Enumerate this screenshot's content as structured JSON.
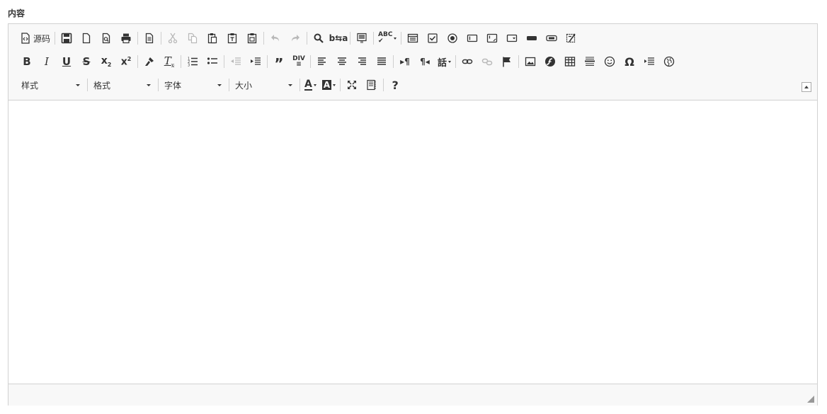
{
  "field": {
    "label": "内容"
  },
  "toolbar": {
    "source_label": "源码",
    "dropdowns": {
      "styles": "样式",
      "format": "格式",
      "font": "字体",
      "size": "大小"
    }
  },
  "icons": [
    "source-icon",
    "save-icon",
    "new-page-icon",
    "preview-icon",
    "print-icon",
    "templates-icon",
    "cut-icon",
    "copy-icon",
    "paste-icon",
    "paste-text-icon",
    "paste-word-icon",
    "undo-icon",
    "redo-icon",
    "find-icon",
    "replace-icon",
    "select-all-icon",
    "spellcheck-icon",
    "form-icon",
    "checkbox-icon",
    "radio-icon",
    "textfield-icon",
    "textarea-icon",
    "select-icon",
    "button-icon",
    "image-button-icon",
    "hidden-field-icon",
    "bold-icon",
    "italic-icon",
    "underline-icon",
    "strike-icon",
    "subscript-icon",
    "superscript-icon",
    "copy-formatting-icon",
    "remove-format-icon",
    "numbered-list-icon",
    "bulleted-list-icon",
    "outdent-icon",
    "indent-icon",
    "blockquote-icon",
    "create-div-icon",
    "align-left-icon",
    "align-center-icon",
    "align-right-icon",
    "justify-icon",
    "ltr-icon",
    "rtl-icon",
    "language-icon",
    "link-icon",
    "unlink-icon",
    "anchor-icon",
    "image-icon",
    "flash-icon",
    "table-icon",
    "horizontal-rule-icon",
    "smiley-icon",
    "special-char-icon",
    "page-break-icon",
    "iframe-icon",
    "text-color-icon",
    "bg-color-icon",
    "maximize-icon",
    "show-blocks-icon",
    "help-icon",
    "collapse-toolbar-icon",
    "resize-handle-icon"
  ],
  "colors": {
    "toolbar_bg": "#f8f8f8",
    "border": "#d1d1d1",
    "icon": "#333333",
    "disabled_icon": "#b8b8b8"
  }
}
